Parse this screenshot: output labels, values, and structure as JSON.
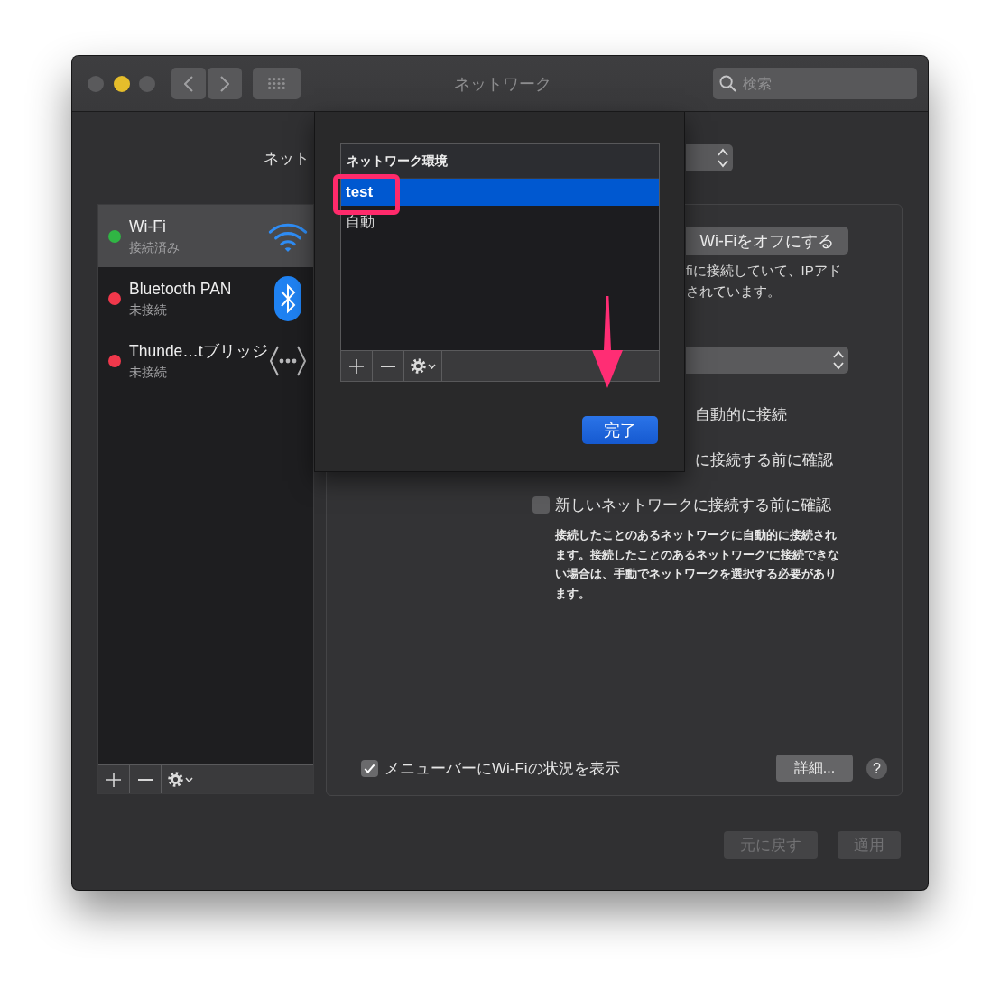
{
  "window": {
    "title": "ネットワーク",
    "traffic_lights": [
      {
        "color": "#5a5a5c"
      },
      {
        "color": "#e5bd2b"
      },
      {
        "color": "#5a5a5c"
      }
    ],
    "search": {
      "placeholder": "検索"
    }
  },
  "location": {
    "label": "ネット"
  },
  "sidebar": {
    "items": [
      {
        "kind": "wifi",
        "name": "Wi-Fi",
        "status": "接続済み",
        "color": "#30b544",
        "selected": true
      },
      {
        "kind": "bluetooth",
        "name": "Bluetooth PAN",
        "status": "未接続",
        "color": "#f0384b",
        "selected": false
      },
      {
        "kind": "bridge",
        "name": "Thunde…tブリッジ",
        "status": "未接続",
        "color": "#f0384b",
        "selected": false
      }
    ]
  },
  "panel": {
    "wifi_button": "Wi-Fiをオフにする",
    "status_lines": [
      "fiに接続していて、IPアド",
      "されています。"
    ],
    "options": [
      {
        "kind": "clipped",
        "label": "自動的に接続"
      },
      {
        "kind": "clipped",
        "label": "に接続する前に確認"
      },
      {
        "kind": "checkbox",
        "label": "新しいネットワークに接続する前に確認",
        "checked": false
      }
    ],
    "note": "接続したことのあるネットワークに自動的に接続されます。接続したことのあるネットワーク'に接続できない場合は、手動でネットワークを選択する必要があります。",
    "menubar_option": {
      "label": "メニューバーにWi-Fiの状況を表示",
      "checked": true
    },
    "advanced_button": "詳細...",
    "help_button": "?"
  },
  "footer": {
    "buttons": [
      {
        "label": "元に戻す",
        "disabled": true
      },
      {
        "label": "適用",
        "disabled": true
      }
    ]
  },
  "sheet": {
    "list": {
      "header": "ネットワーク環境",
      "items": [
        {
          "label": "test",
          "selected": true
        },
        {
          "label": "自動",
          "selected": false
        }
      ]
    },
    "done_button": "完了"
  }
}
